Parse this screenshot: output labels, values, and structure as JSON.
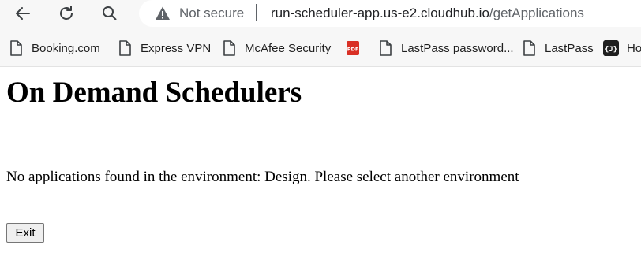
{
  "browser": {
    "nav": {
      "back_icon": "arrow-left-icon",
      "reload_icon": "reload-icon",
      "search_icon": "search-icon"
    },
    "omnibox": {
      "security_icon": "warning-triangle-icon",
      "security_label": "Not secure",
      "url_host": "run-scheduler-app.us-e2.cloudhub.io",
      "url_path": "/getApplications"
    },
    "bookmarks": [
      {
        "label": "Booking.com",
        "icon": "page-icon"
      },
      {
        "label": "Express VPN",
        "icon": "page-icon"
      },
      {
        "label": "McAfee Security",
        "icon": "page-icon"
      },
      {
        "label": "",
        "icon": "pdf-icon",
        "icon_text": "PDF"
      },
      {
        "label": "LastPass password...",
        "icon": "page-icon"
      },
      {
        "label": "LastPass",
        "icon": "page-icon"
      },
      {
        "label": "Ho",
        "icon": "json-icon",
        "icon_text": "{J}"
      }
    ]
  },
  "page": {
    "title": "On Demand Schedulers",
    "message": "No applications found in the environment: Design. Please select another environment",
    "exit_label": "Exit"
  },
  "colors": {
    "chrome_background": "#f7f7f7",
    "omnibox_background": "#ffffff",
    "muted_text": "#5f6368",
    "pdf_red": "#d93025"
  }
}
